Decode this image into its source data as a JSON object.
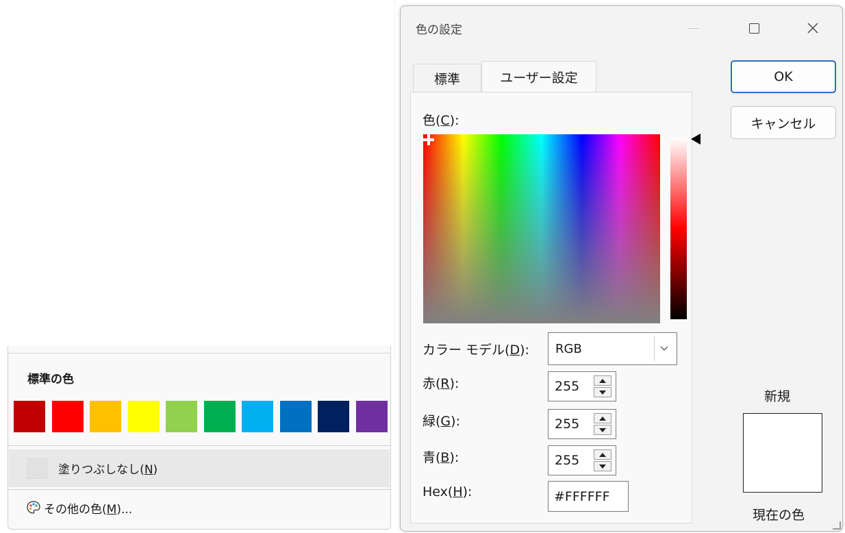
{
  "color_menu": {
    "heading": "標準の色",
    "swatches": [
      {
        "name": "dark-red",
        "color": "#C00000"
      },
      {
        "name": "red",
        "color": "#FF0000"
      },
      {
        "name": "orange",
        "color": "#FFC000"
      },
      {
        "name": "yellow",
        "color": "#FFFF00"
      },
      {
        "name": "light-green",
        "color": "#92D050"
      },
      {
        "name": "green",
        "color": "#00B050"
      },
      {
        "name": "light-blue",
        "color": "#00B0F0"
      },
      {
        "name": "blue",
        "color": "#0070C0"
      },
      {
        "name": "dark-blue",
        "color": "#002060"
      },
      {
        "name": "purple",
        "color": "#7030A0"
      }
    ],
    "no_fill": {
      "label": "塗りつぶしなし(",
      "hotkey": "N",
      "suffix": ")"
    },
    "more_colors": {
      "label": "その他の色(",
      "hotkey": "M",
      "suffix": ")...",
      "icon": "palette-icon"
    }
  },
  "dialog": {
    "title": "色の設定",
    "window_controls": {
      "minimize": "minimize-icon",
      "maximize": "maximize-icon",
      "close": "close-icon"
    },
    "tabs": [
      {
        "label": "標準",
        "active": false
      },
      {
        "label": "ユーザー設定",
        "active": true
      }
    ],
    "color_label": {
      "text": "色(",
      "hotkey": "C",
      "suffix": "):"
    },
    "color_model": {
      "label": "カラー モデル(",
      "hotkey": "D",
      "suffix": "):",
      "value": "RGB"
    },
    "red": {
      "label": "赤(",
      "hotkey": "R",
      "suffix": "):",
      "value": "255"
    },
    "green": {
      "label": "緑(",
      "hotkey": "G",
      "suffix": "):",
      "value": "255"
    },
    "blue": {
      "label": "青(",
      "hotkey": "B",
      "suffix": "):",
      "value": "255"
    },
    "hex": {
      "label": "Hex(",
      "hotkey": "H",
      "suffix": "):",
      "value": "#FFFFFF"
    },
    "ok_label": "OK",
    "cancel_label": "キャンセル",
    "new_label": "新規",
    "current_label": "現在の色",
    "preview_color": "#FFFFFF"
  }
}
